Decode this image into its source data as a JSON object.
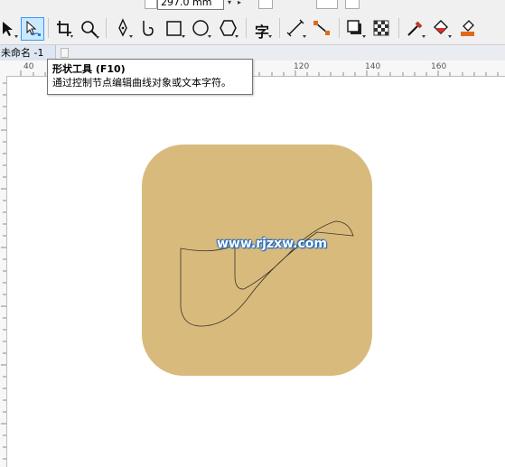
{
  "propbar": {
    "page_height": "297.0 mm"
  },
  "toolbox": {
    "tools": [
      {
        "name": "pick-tool",
        "icon": "arrow-pointer-icon"
      },
      {
        "name": "shape-tool",
        "icon": "shape-node-icon",
        "active": true
      },
      {
        "name": "crop-tool",
        "icon": "crop-icon"
      },
      {
        "name": "zoom-tool",
        "icon": "magnifier-icon"
      },
      {
        "name": "pen-tool",
        "icon": "pen-nib-icon"
      },
      {
        "name": "freehand-tool",
        "icon": "curve-icon"
      },
      {
        "name": "rectangle-tool",
        "icon": "rectangle-icon"
      },
      {
        "name": "ellipse-tool",
        "icon": "ellipse-icon"
      },
      {
        "name": "polygon-tool",
        "icon": "hexagon-icon"
      },
      {
        "name": "text-tool",
        "icon": "text-zi-icon"
      },
      {
        "name": "parallel-dimension-tool",
        "icon": "dimension-line-icon"
      },
      {
        "name": "connector-tool",
        "icon": "connector-icon"
      },
      {
        "name": "drop-shadow-tool",
        "icon": "drop-shadow-icon"
      },
      {
        "name": "transparency-tool",
        "icon": "checkerboard-icon"
      },
      {
        "name": "eyedropper-tool",
        "icon": "eyedropper-icon"
      },
      {
        "name": "interactive-fill-tool",
        "icon": "fill-bucket-icon"
      },
      {
        "name": "smart-fill-tool",
        "icon": "smart-fill-icon"
      }
    ],
    "text_tool_glyph": "字"
  },
  "tabbar": {
    "doc_tab": "未命名 -1"
  },
  "ruler": {
    "labels": [
      "40",
      "120",
      "140",
      "160"
    ]
  },
  "colors": {
    "icon_fill": "#d8bb7c",
    "accent": "#3399ff"
  },
  "watermark": {
    "text": "www.rjzxw.com"
  },
  "tooltip": {
    "title": "形状工具 (F10)",
    "desc": "通过控制节点编辑曲线对象或文本字符。"
  }
}
